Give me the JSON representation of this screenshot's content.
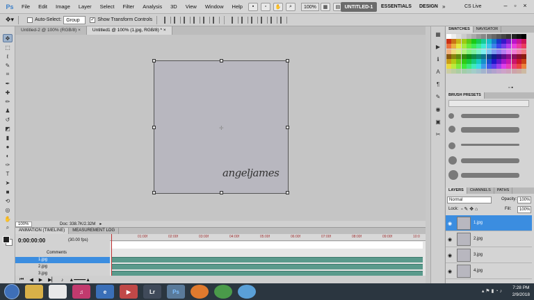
{
  "menubar": {
    "logo": "Ps",
    "items": [
      "File",
      "Edit",
      "Image",
      "Layer",
      "Select",
      "Filter",
      "Analysis",
      "3D",
      "View",
      "Window",
      "Help"
    ],
    "zoom": "100%",
    "workspaces": {
      "active": "UNTITLED-1",
      "essentials": "ESSENTIALS",
      "design": "DESIGN",
      "more": "»"
    },
    "cslive": "CS Live"
  },
  "options": {
    "auto_select_label": "Auto-Select:",
    "auto_select_value": "Group",
    "show_transform_label": "Show Transform Controls"
  },
  "doctabs": [
    {
      "label": "Untitled-2 @ 100% (RGB/8)"
    },
    {
      "label": "Untitled1 @ 100% (1.jpg, RGB/8) *"
    }
  ],
  "canvas": {
    "signature": "angeljames"
  },
  "status": {
    "zoom": "100%",
    "doc": "Doc: 338.7K/2.32M"
  },
  "animation": {
    "tabs": [
      "ANIMATION (TIMELINE)",
      "MEASUREMENT LOG"
    ],
    "timecode": "0:00:00:00",
    "fps": "(30.00 fps)",
    "comments": "Comments",
    "layers": [
      "1.jpg",
      "2.jpg",
      "3.jpg"
    ],
    "ruler": [
      "01:00f",
      "02:00f",
      "03:00f",
      "04:00f",
      "05:00f",
      "06:00f",
      "07:00f",
      "08:00f",
      "09:00f",
      "10:0"
    ]
  },
  "panels": {
    "swatch_tabs": [
      "SWATCHES",
      "NAVIGATOR"
    ],
    "brush_tab": "BRUSH PRESETS",
    "layer_tabs": [
      "LAYERS",
      "CHANNELS",
      "PATHS"
    ],
    "blend_mode": "Normal",
    "opacity_label": "Opacity:",
    "opacity": "100%",
    "lock_label": "Lock:",
    "fill_label": "Fill:",
    "fill": "100%",
    "layers": [
      "1.jpg",
      "2.jpg",
      "3.jpg",
      "4.jpg"
    ]
  },
  "taskbar": {
    "apps": [
      "file-explorer",
      "media-player",
      "itunes",
      "ie-icon",
      "media-icon",
      "lightroom",
      "photoshop",
      "firefox",
      "chrome",
      "paint"
    ],
    "lr": "Lr",
    "ps": "Ps",
    "time": "7:28 PM",
    "date": "2/9/2018"
  }
}
